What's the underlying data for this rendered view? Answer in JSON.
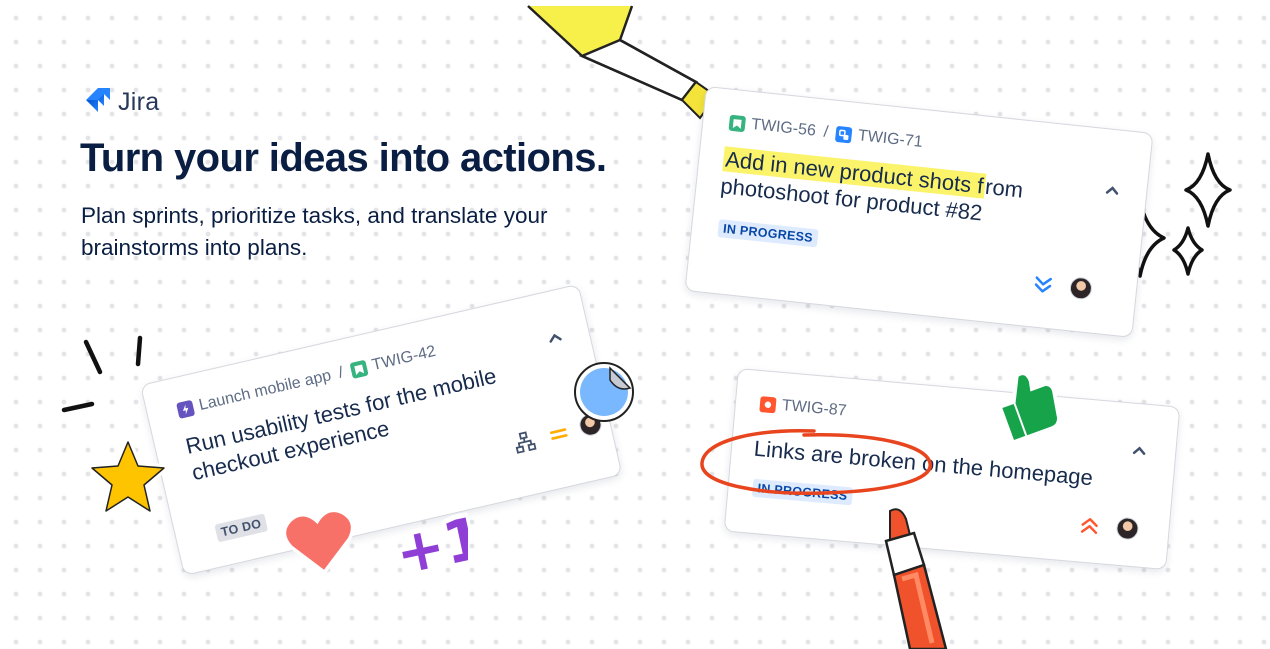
{
  "header": {
    "logo_text": "Jira",
    "headline": "Turn your ideas into actions.",
    "subline": "Plan sprints, prioritize tasks, and translate your brainstorms into plans."
  },
  "cards": [
    {
      "parent_key": "TWIG-56",
      "key": "TWIG-71",
      "title_highlighted": "Add in new product shots f",
      "title_rest": "rom photoshoot for product #82",
      "status": "IN PROGRESS",
      "priority_icon": "lowest-priority-icon"
    },
    {
      "parent_key": "Launch mobile app",
      "key": "TWIG-42",
      "title": "Run usability tests for the mobile checkout experience",
      "status": "TO DO",
      "priority_icon": "medium-priority-icon"
    },
    {
      "key": "TWIG-87",
      "title": "Links are broken on the homepage",
      "status": "IN PROGRESS",
      "priority_icon": "high-priority-icon"
    }
  ],
  "stickers": {
    "plus_one": "+1"
  },
  "colors": {
    "brand_blue": "#2684ff",
    "story_green": "#36b37e",
    "epic_purple": "#6554c0",
    "bug_red": "#ff5630",
    "highlight_yellow": "#fbf36a",
    "marker_orange": "#f0522b"
  }
}
